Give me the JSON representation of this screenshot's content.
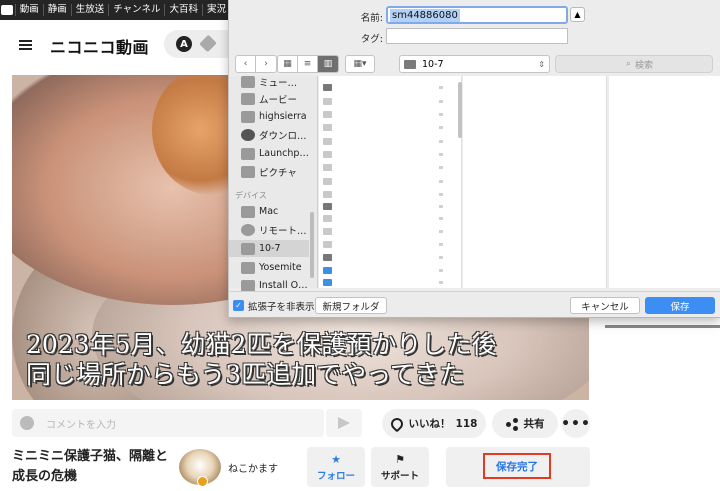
{
  "nico": {
    "topbar": [
      "動画",
      "静画",
      "生放送",
      "チャンネル",
      "大百科",
      "実況"
    ],
    "brand": "ニコニコ動画",
    "account_badge": "A"
  },
  "video": {
    "caption_line1": "2023年5月、幼猫2匹を保護預かりした後",
    "caption_line2": "同じ場所からもう3匹追加でやってきた"
  },
  "comment": {
    "placeholder": "コメントを入力"
  },
  "actions": {
    "like_label": "いいね！",
    "like_count": "118",
    "share_label": "共有",
    "more_label": "•••"
  },
  "info": {
    "title": "ミニミニ保護子猫、隔離と成長の危機",
    "uploader": "ねこかます",
    "follow_label": "フォロー",
    "support_label": "サポート",
    "save_done_label": "保存完了"
  },
  "dialog": {
    "name_label": "名前:",
    "name_value": "sm44886080",
    "tag_label": "タグ:",
    "tag_value": "",
    "folder": "10-7",
    "search_placeholder": "検索",
    "sidebar": [
      {
        "label": "ミュー…",
        "icon": "music-icon"
      },
      {
        "label": "ムービー",
        "icon": "movie-icon"
      },
      {
        "label": "highsierra",
        "icon": "home-icon"
      },
      {
        "label": "ダウンロ…",
        "icon": "download-icon"
      },
      {
        "label": "Launchp…",
        "icon": "launchpad-icon"
      },
      {
        "label": "ピクチャ",
        "icon": "camera-icon"
      }
    ],
    "devices_header": "デバイス",
    "devices": [
      {
        "label": "Mac",
        "icon": "drive-icon"
      },
      {
        "label": "リモート…",
        "icon": "disc-icon"
      },
      {
        "label": "10-7",
        "icon": "drive-icon",
        "selected": true
      },
      {
        "label": "Yosemite",
        "icon": "drive-icon"
      },
      {
        "label": "Install O…",
        "icon": "drive-icon"
      }
    ],
    "hide_ext_label": "拡張子を非表示",
    "new_folder_label": "新規フォルダ",
    "cancel_label": "キャンセル",
    "save_label": "保存"
  }
}
